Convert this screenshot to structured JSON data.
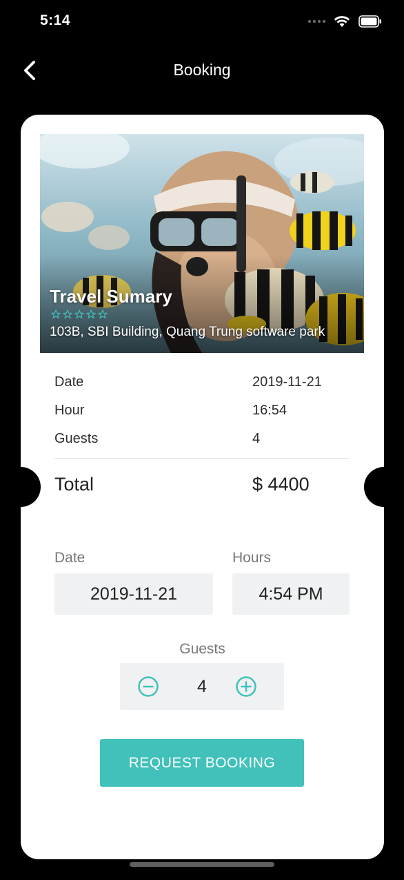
{
  "status_bar": {
    "time": "5:14"
  },
  "nav": {
    "title": "Booking",
    "back_icon": "chevron-left-icon"
  },
  "hero": {
    "title": "Travel Sumary",
    "rating": {
      "filled": 0,
      "max": 5
    },
    "address": "103B, SBI Building, Quang Trung software park"
  },
  "summary": {
    "rows": [
      {
        "label": "Date",
        "value": "2019-11-21"
      },
      {
        "label": "Hour",
        "value": "16:54"
      },
      {
        "label": "Guests",
        "value": "4"
      }
    ],
    "total_label": "Total",
    "total_value": "$ 4400"
  },
  "form": {
    "date_label": "Date",
    "date_value": "2019-11-21",
    "hours_label": "Hours",
    "hours_value": "4:54 PM",
    "guests_label": "Guests",
    "guests_value": "4"
  },
  "cta": {
    "label": "REQUEST BOOKING"
  },
  "colors": {
    "accent": "#41c1ba",
    "field_bg": "#f0f1f3",
    "background": "#000000"
  }
}
